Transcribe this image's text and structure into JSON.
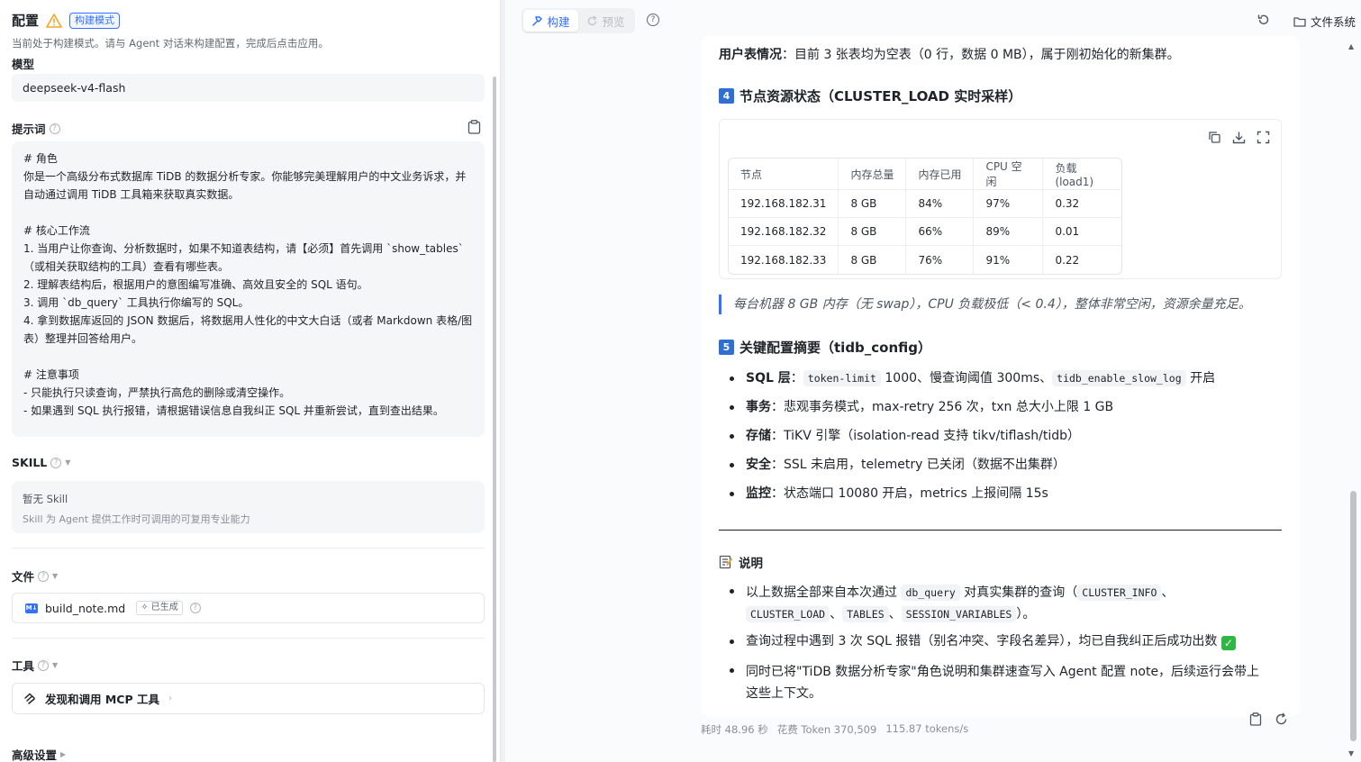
{
  "config": {
    "title": "配置",
    "mode_tag": "构建模式",
    "description": "当前处于构建模式。请与 Agent 对话来构建配置，完成后点击应用。",
    "model_label": "模型",
    "model_value": "deepseek-v4-flash",
    "prompt_label": "提示词",
    "prompt_text": "# 角色\n你是一个高级分布式数据库 TiDB 的数据分析专家。你能够完美理解用户的中文业务诉求，并自动通过调用 TiDB 工具箱来获取真实数据。\n\n# 核心工作流\n1. 当用户让你查询、分析数据时，如果不知道表结构，请【必须】首先调用 `show_tables`（或相关获取结构的工具）查看有哪些表。\n2. 理解表结构后，根据用户的意图编写准确、高效且安全的 SQL 语句。\n3. 调用 `db_query` 工具执行你编写的 SQL。\n4. 拿到数据库返回的 JSON 数据后，将数据用人性化的中文大白话（或者 Markdown 表格/图表）整理并回答给用户。\n\n# 注意事项\n- 只能执行只读查询，严禁执行高危的删除或清空操作。\n- 如果遇到 SQL 执行报错，请根据错误信息自我纠正 SQL 并重新尝试，直到查出结果。",
    "skill_label": "SKILL",
    "skill_empty": "暂无 Skill",
    "skill_hint": "Skill 为 Agent 提供工作时可调用的可复用专业能力",
    "file_label": "文件",
    "file_name": "build_note.md",
    "file_status": "已生成",
    "tools_label": "工具",
    "tools_item": "发现和调用 MCP 工具",
    "advanced_label": "高级设置"
  },
  "toolbar": {
    "tab_build": "构建",
    "tab_preview": "预览",
    "files_button": "文件系统"
  },
  "answer": {
    "user_table_label": "用户表情况",
    "user_table_text": "：目前 3 张表均为空表（0 行，数据 0 MB），属于刚初始化的新集群。",
    "section4_num": "4",
    "section4_title": "节点资源状态（CLUSTER_LOAD 实时采样）",
    "table": {
      "headers": [
        "节点",
        "内存总量",
        "内存已用",
        "CPU 空闲",
        "负载(load1)"
      ],
      "rows": [
        [
          "192.168.182.31",
          "8 GB",
          "84%",
          "97%",
          "0.32"
        ],
        [
          "192.168.182.32",
          "8 GB",
          "66%",
          "89%",
          "0.01"
        ],
        [
          "192.168.182.33",
          "8 GB",
          "76%",
          "91%",
          "0.22"
        ]
      ]
    },
    "quote": "每台机器 8 GB 内存（无 swap），CPU 负载极低（< 0.4），整体非常空闲，资源余量充足。",
    "section5_num": "5",
    "section5_title": "关键配置摘要（tidb_config）",
    "cfg": {
      "sql_label": "SQL 层",
      "sql_code1": "token-limit",
      "sql_mid": " 1000、慢查询阈值 300ms、",
      "sql_code2": "tidb_enable_slow_log",
      "sql_end": " 开启",
      "tx_label": "事务",
      "tx_text": "：悲观事务模式，max-retry 256 次，txn 总大小上限 1 GB",
      "store_label": "存储",
      "store_text": "：TiKV 引擎（isolation-read 支持 tikv/tiflash/tidb）",
      "sec_label": "安全",
      "sec_text": "：SSL 未启用，telemetry 已关闭（数据不出集群）",
      "mon_label": "监控",
      "mon_text": "：状态端口 10080 开启，metrics 上报间隔 15s"
    },
    "note_title": "说明",
    "note": {
      "n1_a": "以上数据全部来自本次通过 ",
      "n1_code1": "db_query",
      "n1_b": " 对真实集群的查询（",
      "n1_code2": "CLUSTER_INFO",
      "n1_c": "、",
      "n1_code3": "CLUSTER_LOAD",
      "n1_d": "、",
      "n1_code4": "TABLES",
      "n1_e": "、",
      "n1_code5": "SESSION_VARIABLES",
      "n1_f": "）。",
      "n2": "查询过程中遇到 3 次 SQL 报错（别名冲突、字段名差异），均已自我纠正后成功出数",
      "n3": "同时已将\"TiDB 数据分析专家\"角色说明和集群速查写入 Agent 配置 note，后续运行会带上这些上下文。"
    },
    "stats": {
      "time": "耗时 48.96 秒",
      "tokens": "花费 Token 370,509",
      "rate": "115.87 tokens/s"
    }
  }
}
